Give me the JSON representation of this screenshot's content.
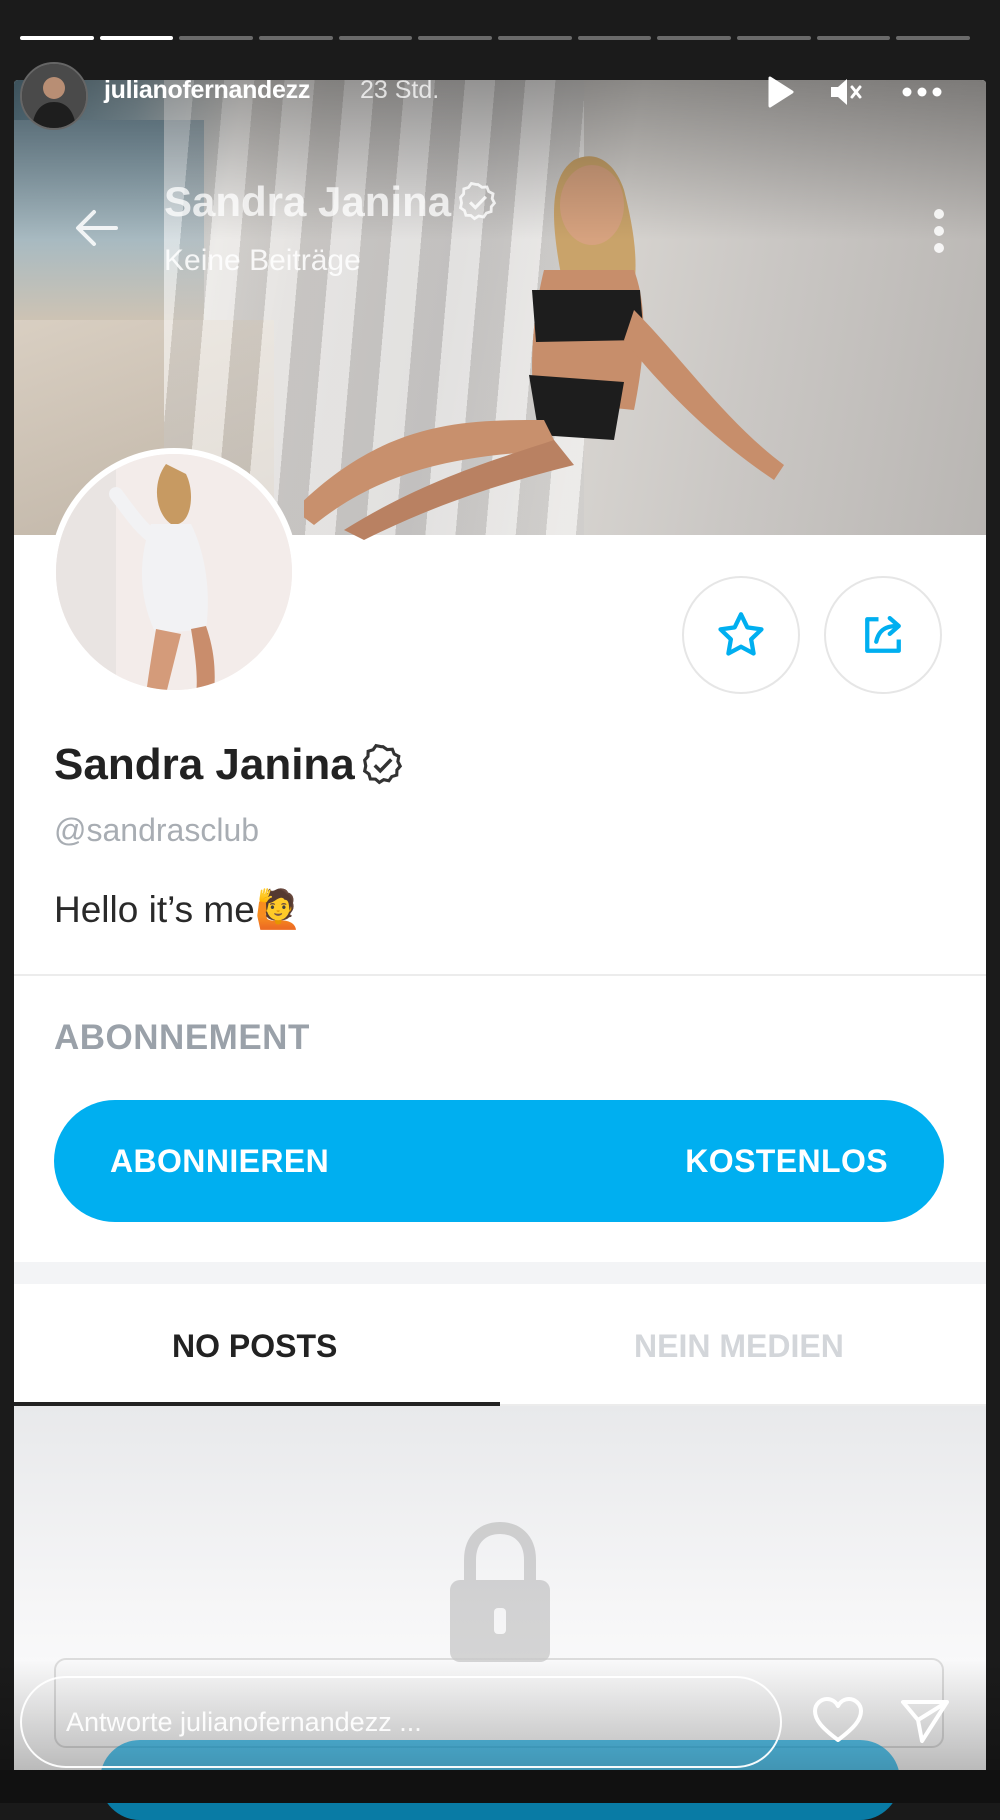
{
  "story": {
    "username": "julianofernandezz",
    "time_ago": "23 Std.",
    "progress": {
      "total_segments": 12,
      "completed_segments": 2
    },
    "reply_placeholder": "Antworte julianofernandezz ...",
    "icons": [
      "play-icon",
      "mute-icon",
      "more-icon",
      "heart-icon",
      "send-icon"
    ]
  },
  "profile": {
    "topbar_title": "Sandra Janina",
    "topbar_subtitle": "Keine Beiträge",
    "name": "Sandra Janina",
    "handle": "@sandrasclub",
    "bio": "Hello it’s me",
    "bio_emoji": "🙋",
    "subscription_label": "ABONNEMENT",
    "subscribe_button": "ABONNIEREN",
    "subscribe_price": "KOSTENLOS",
    "tabs": [
      {
        "label": "NO POSTS",
        "active": true
      },
      {
        "label": "NEIN MEDIEN",
        "active": false
      }
    ],
    "accent_color": "#00aff0",
    "icons": [
      "back-arrow-icon",
      "kebab-icon",
      "verified-icon",
      "star-icon",
      "share-icon",
      "lock-icon"
    ]
  }
}
